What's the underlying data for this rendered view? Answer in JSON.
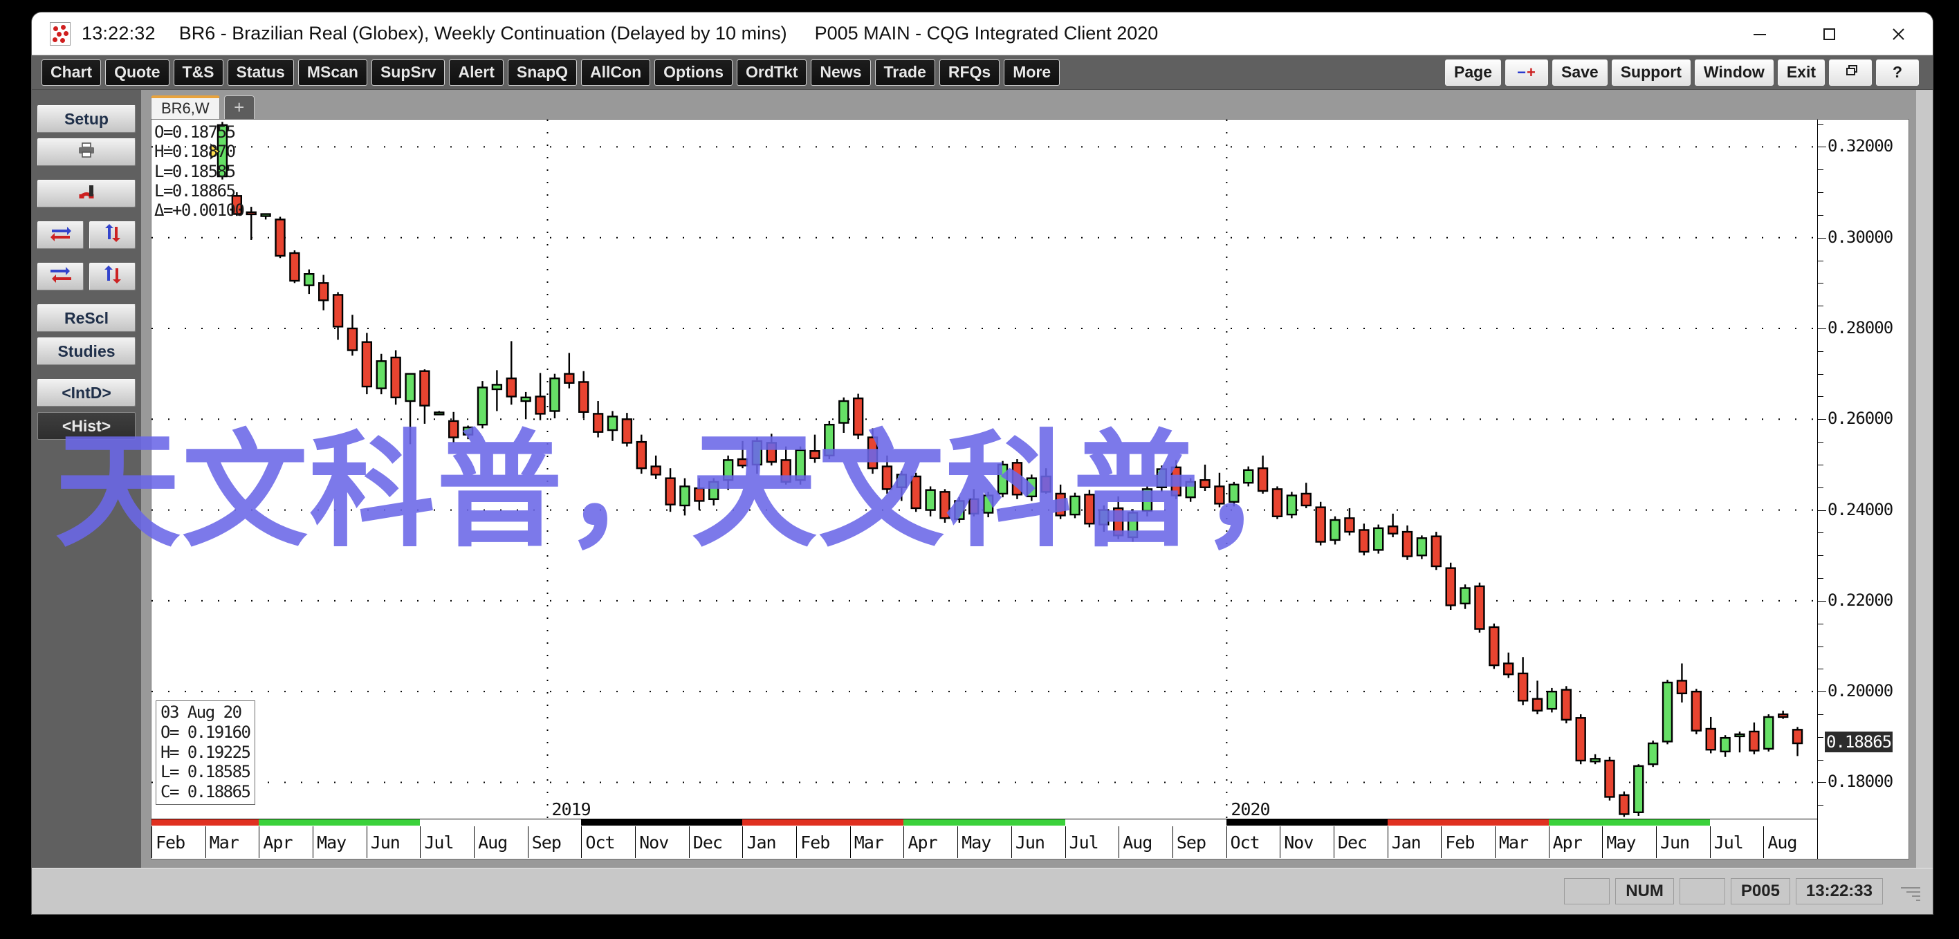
{
  "window": {
    "clock": "13:22:32",
    "title": "BR6 - Brazilian Real (Globex), Weekly Continuation (Delayed by 10 mins)",
    "subtitle": "P005 MAIN - CQG Integrated Client 2020",
    "controls": {
      "minimize": "minimize-icon",
      "maximize": "maximize-icon",
      "close": "close-icon"
    }
  },
  "toolbar": {
    "left_buttons": [
      "Chart",
      "Quote",
      "T&S",
      "Status",
      "MScan",
      "SupSrv",
      "Alert",
      "SnapQ",
      "AllCon",
      "Options",
      "OrdTkt",
      "News",
      "Trade",
      "RFQs",
      "More"
    ],
    "right_buttons": [
      "Page",
      "-+",
      "Save",
      "Support",
      "Window",
      "Exit"
    ],
    "restore_icon": "restore-window-icon",
    "help_icon": "help-question-icon"
  },
  "sidebar": {
    "setup": "Setup",
    "print_icon": "printer-icon",
    "magnet_icon": "magnet-icon",
    "arrow_icons": [
      "swap-horizontal-icon",
      "swap-vertical-icon",
      "collapse-horizontal-icon",
      "expand-vertical-icon"
    ],
    "rescale": "ReScl",
    "studies": "Studies",
    "intraday": "<IntD>",
    "history": "<Hist>"
  },
  "tabs": {
    "active": "BR6,W",
    "add": "+"
  },
  "chart_data": {
    "type": "candlestick",
    "title": "BR6 - Brazilian Real (Globex), Weekly Continuation",
    "xlabel": "",
    "ylabel": "",
    "ylim": [
      0.172,
      0.326
    ],
    "grid": true,
    "price_ticks": [
      "0.32000",
      "0.30000",
      "0.28000",
      "0.26000",
      "0.24000",
      "0.22000",
      "0.20000",
      "0.18000"
    ],
    "price_tick_values": [
      0.32,
      0.3,
      0.28,
      0.26,
      0.24,
      0.22,
      0.2,
      0.18
    ],
    "last_price_label": "0.18865",
    "last_price_value": 0.18865,
    "header": {
      "open": "O=0.18755",
      "high": "H=0.18870",
      "low": "L=0.18585",
      "close": "L=0.18865",
      "delta": "Δ=+0.00100"
    },
    "cursor_box": {
      "date": "03 Aug 20",
      "open": "O= 0.19160",
      "high": "H= 0.19225",
      "low": "L= 0.18585",
      "close": "C= 0.18865"
    },
    "year_labels": [
      "2019",
      "2020"
    ],
    "month_labels": [
      "Feb",
      "Mar",
      "Apr",
      "May",
      "Jun",
      "Jul",
      "Aug",
      "Sep",
      "Oct",
      "Nov",
      "Dec",
      "Jan",
      "Feb",
      "Mar",
      "Apr",
      "May",
      "Jun",
      "Jul",
      "Aug",
      "Sep",
      "Oct",
      "Nov",
      "Dec",
      "Jan",
      "Feb",
      "Mar",
      "Apr",
      "May",
      "Jun",
      "Jul",
      "Aug"
    ],
    "candles": [
      {
        "o": 0.3135,
        "h": 0.3255,
        "l": 0.3128,
        "c": 0.3248,
        "d": "u"
      },
      {
        "o": 0.3092,
        "h": 0.31,
        "l": 0.3048,
        "c": 0.3052,
        "d": "d"
      },
      {
        "o": 0.3056,
        "h": 0.3068,
        "l": 0.2995,
        "c": 0.3056,
        "d": "d"
      },
      {
        "o": 0.305,
        "h": 0.3052,
        "l": 0.304,
        "c": 0.3052,
        "d": "u"
      },
      {
        "o": 0.304,
        "h": 0.3046,
        "l": 0.2955,
        "c": 0.296,
        "d": "d"
      },
      {
        "o": 0.2966,
        "h": 0.2972,
        "l": 0.29,
        "c": 0.2905,
        "d": "d"
      },
      {
        "o": 0.2895,
        "h": 0.293,
        "l": 0.2876,
        "c": 0.292,
        "d": "u"
      },
      {
        "o": 0.29,
        "h": 0.2918,
        "l": 0.284,
        "c": 0.2862,
        "d": "d"
      },
      {
        "o": 0.2874,
        "h": 0.288,
        "l": 0.2775,
        "c": 0.2804,
        "d": "d"
      },
      {
        "o": 0.28,
        "h": 0.283,
        "l": 0.274,
        "c": 0.2752,
        "d": "d"
      },
      {
        "o": 0.277,
        "h": 0.279,
        "l": 0.2655,
        "c": 0.2672,
        "d": "d"
      },
      {
        "o": 0.2668,
        "h": 0.2744,
        "l": 0.2655,
        "c": 0.2728,
        "d": "u"
      },
      {
        "o": 0.2736,
        "h": 0.2752,
        "l": 0.2632,
        "c": 0.2648,
        "d": "d"
      },
      {
        "o": 0.264,
        "h": 0.27,
        "l": 0.2545,
        "c": 0.27,
        "d": "u"
      },
      {
        "o": 0.2706,
        "h": 0.271,
        "l": 0.259,
        "c": 0.263,
        "d": "d"
      },
      {
        "o": 0.2612,
        "h": 0.2618,
        "l": 0.261,
        "c": 0.2615,
        "d": "u"
      },
      {
        "o": 0.2596,
        "h": 0.2616,
        "l": 0.2548,
        "c": 0.256,
        "d": "d"
      },
      {
        "o": 0.2566,
        "h": 0.2586,
        "l": 0.2556,
        "c": 0.2582,
        "d": "u"
      },
      {
        "o": 0.2588,
        "h": 0.2684,
        "l": 0.258,
        "c": 0.267,
        "d": "u"
      },
      {
        "o": 0.2666,
        "h": 0.2708,
        "l": 0.2618,
        "c": 0.2676,
        "d": "u"
      },
      {
        "o": 0.269,
        "h": 0.2772,
        "l": 0.2632,
        "c": 0.265,
        "d": "d"
      },
      {
        "o": 0.264,
        "h": 0.266,
        "l": 0.26,
        "c": 0.2648,
        "d": "u"
      },
      {
        "o": 0.265,
        "h": 0.2702,
        "l": 0.2598,
        "c": 0.2612,
        "d": "d"
      },
      {
        "o": 0.2618,
        "h": 0.27,
        "l": 0.2602,
        "c": 0.269,
        "d": "u"
      },
      {
        "o": 0.27,
        "h": 0.2746,
        "l": 0.2668,
        "c": 0.268,
        "d": "d"
      },
      {
        "o": 0.2682,
        "h": 0.2706,
        "l": 0.2602,
        "c": 0.2616,
        "d": "d"
      },
      {
        "o": 0.2612,
        "h": 0.264,
        "l": 0.256,
        "c": 0.2572,
        "d": "d"
      },
      {
        "o": 0.2576,
        "h": 0.2618,
        "l": 0.2552,
        "c": 0.2606,
        "d": "u"
      },
      {
        "o": 0.26,
        "h": 0.2614,
        "l": 0.254,
        "c": 0.2548,
        "d": "d"
      },
      {
        "o": 0.255,
        "h": 0.2566,
        "l": 0.248,
        "c": 0.2492,
        "d": "d"
      },
      {
        "o": 0.2496,
        "h": 0.252,
        "l": 0.2468,
        "c": 0.2478,
        "d": "d"
      },
      {
        "o": 0.247,
        "h": 0.2492,
        "l": 0.2396,
        "c": 0.2412,
        "d": "d"
      },
      {
        "o": 0.241,
        "h": 0.247,
        "l": 0.2388,
        "c": 0.2452,
        "d": "u"
      },
      {
        "o": 0.2448,
        "h": 0.247,
        "l": 0.24,
        "c": 0.242,
        "d": "d"
      },
      {
        "o": 0.2424,
        "h": 0.247,
        "l": 0.241,
        "c": 0.2462,
        "d": "u"
      },
      {
        "o": 0.2466,
        "h": 0.252,
        "l": 0.2444,
        "c": 0.251,
        "d": "u"
      },
      {
        "o": 0.2512,
        "h": 0.2552,
        "l": 0.2492,
        "c": 0.2498,
        "d": "d"
      },
      {
        "o": 0.25,
        "h": 0.256,
        "l": 0.248,
        "c": 0.2552,
        "d": "u"
      },
      {
        "o": 0.2548,
        "h": 0.2568,
        "l": 0.2498,
        "c": 0.2506,
        "d": "d"
      },
      {
        "o": 0.251,
        "h": 0.254,
        "l": 0.2456,
        "c": 0.2462,
        "d": "d"
      },
      {
        "o": 0.2466,
        "h": 0.254,
        "l": 0.2456,
        "c": 0.2532,
        "d": "u"
      },
      {
        "o": 0.253,
        "h": 0.2566,
        "l": 0.2504,
        "c": 0.2514,
        "d": "d"
      },
      {
        "o": 0.252,
        "h": 0.2596,
        "l": 0.2512,
        "c": 0.2588,
        "d": "u"
      },
      {
        "o": 0.2592,
        "h": 0.2648,
        "l": 0.257,
        "c": 0.264,
        "d": "u"
      },
      {
        "o": 0.2646,
        "h": 0.2656,
        "l": 0.2556,
        "c": 0.2566,
        "d": "d"
      },
      {
        "o": 0.256,
        "h": 0.258,
        "l": 0.248,
        "c": 0.2492,
        "d": "d"
      },
      {
        "o": 0.2496,
        "h": 0.252,
        "l": 0.2436,
        "c": 0.2446,
        "d": "d"
      },
      {
        "o": 0.245,
        "h": 0.2486,
        "l": 0.242,
        "c": 0.2478,
        "d": "u"
      },
      {
        "o": 0.2474,
        "h": 0.2482,
        "l": 0.2396,
        "c": 0.2404,
        "d": "d"
      },
      {
        "o": 0.24,
        "h": 0.2452,
        "l": 0.2386,
        "c": 0.2444,
        "d": "u"
      },
      {
        "o": 0.244,
        "h": 0.2446,
        "l": 0.2372,
        "c": 0.2382,
        "d": "d"
      },
      {
        "o": 0.238,
        "h": 0.2428,
        "l": 0.2372,
        "c": 0.242,
        "d": "u"
      },
      {
        "o": 0.2424,
        "h": 0.2446,
        "l": 0.2386,
        "c": 0.2392,
        "d": "d"
      },
      {
        "o": 0.2394,
        "h": 0.244,
        "l": 0.2384,
        "c": 0.2432,
        "d": "u"
      },
      {
        "o": 0.2436,
        "h": 0.2508,
        "l": 0.2428,
        "c": 0.25,
        "d": "u"
      },
      {
        "o": 0.2504,
        "h": 0.2512,
        "l": 0.2424,
        "c": 0.2434,
        "d": "d"
      },
      {
        "o": 0.243,
        "h": 0.2478,
        "l": 0.242,
        "c": 0.247,
        "d": "u"
      },
      {
        "o": 0.2474,
        "h": 0.2492,
        "l": 0.2436,
        "c": 0.244,
        "d": "d"
      },
      {
        "o": 0.2436,
        "h": 0.2456,
        "l": 0.238,
        "c": 0.2388,
        "d": "d"
      },
      {
        "o": 0.239,
        "h": 0.2438,
        "l": 0.2382,
        "c": 0.243,
        "d": "u"
      },
      {
        "o": 0.2434,
        "h": 0.2444,
        "l": 0.2362,
        "c": 0.237,
        "d": "d"
      },
      {
        "o": 0.2368,
        "h": 0.241,
        "l": 0.2352,
        "c": 0.24,
        "d": "u"
      },
      {
        "o": 0.2404,
        "h": 0.243,
        "l": 0.2336,
        "c": 0.2344,
        "d": "d"
      },
      {
        "o": 0.234,
        "h": 0.2402,
        "l": 0.233,
        "c": 0.2394,
        "d": "u"
      },
      {
        "o": 0.2398,
        "h": 0.2452,
        "l": 0.2386,
        "c": 0.2446,
        "d": "u"
      },
      {
        "o": 0.245,
        "h": 0.2498,
        "l": 0.244,
        "c": 0.249,
        "d": "u"
      },
      {
        "o": 0.2494,
        "h": 0.251,
        "l": 0.2424,
        "c": 0.2432,
        "d": "d"
      },
      {
        "o": 0.2428,
        "h": 0.247,
        "l": 0.2418,
        "c": 0.2462,
        "d": "u"
      },
      {
        "o": 0.2466,
        "h": 0.25,
        "l": 0.2442,
        "c": 0.245,
        "d": "d"
      },
      {
        "o": 0.2452,
        "h": 0.2482,
        "l": 0.2406,
        "c": 0.2414,
        "d": "d"
      },
      {
        "o": 0.2418,
        "h": 0.2462,
        "l": 0.2408,
        "c": 0.2456,
        "d": "u"
      },
      {
        "o": 0.246,
        "h": 0.2496,
        "l": 0.2452,
        "c": 0.2488,
        "d": "u"
      },
      {
        "o": 0.2492,
        "h": 0.252,
        "l": 0.2436,
        "c": 0.2442,
        "d": "d"
      },
      {
        "o": 0.2446,
        "h": 0.2452,
        "l": 0.238,
        "c": 0.2386,
        "d": "d"
      },
      {
        "o": 0.239,
        "h": 0.244,
        "l": 0.2382,
        "c": 0.2432,
        "d": "u"
      },
      {
        "o": 0.2436,
        "h": 0.246,
        "l": 0.2404,
        "c": 0.241,
        "d": "d"
      },
      {
        "o": 0.2406,
        "h": 0.2418,
        "l": 0.2322,
        "c": 0.233,
        "d": "d"
      },
      {
        "o": 0.2334,
        "h": 0.2386,
        "l": 0.2324,
        "c": 0.2378,
        "d": "u"
      },
      {
        "o": 0.2382,
        "h": 0.2404,
        "l": 0.2344,
        "c": 0.2352,
        "d": "d"
      },
      {
        "o": 0.2356,
        "h": 0.237,
        "l": 0.23,
        "c": 0.2308,
        "d": "d"
      },
      {
        "o": 0.2312,
        "h": 0.2368,
        "l": 0.2304,
        "c": 0.236,
        "d": "u"
      },
      {
        "o": 0.2364,
        "h": 0.2392,
        "l": 0.234,
        "c": 0.2348,
        "d": "d"
      },
      {
        "o": 0.2352,
        "h": 0.2366,
        "l": 0.229,
        "c": 0.2298,
        "d": "d"
      },
      {
        "o": 0.23,
        "h": 0.2344,
        "l": 0.2292,
        "c": 0.2338,
        "d": "u"
      },
      {
        "o": 0.2342,
        "h": 0.2352,
        "l": 0.2268,
        "c": 0.2276,
        "d": "d"
      },
      {
        "o": 0.2272,
        "h": 0.2284,
        "l": 0.218,
        "c": 0.219,
        "d": "d"
      },
      {
        "o": 0.2194,
        "h": 0.2236,
        "l": 0.2182,
        "c": 0.2228,
        "d": "u"
      },
      {
        "o": 0.2232,
        "h": 0.224,
        "l": 0.213,
        "c": 0.2138,
        "d": "d"
      },
      {
        "o": 0.2142,
        "h": 0.215,
        "l": 0.205,
        "c": 0.2058,
        "d": "d"
      },
      {
        "o": 0.2062,
        "h": 0.2086,
        "l": 0.203,
        "c": 0.2038,
        "d": "d"
      },
      {
        "o": 0.204,
        "h": 0.2076,
        "l": 0.197,
        "c": 0.198,
        "d": "d"
      },
      {
        "o": 0.1984,
        "h": 0.2024,
        "l": 0.195,
        "c": 0.1958,
        "d": "d"
      },
      {
        "o": 0.1962,
        "h": 0.2008,
        "l": 0.1954,
        "c": 0.2,
        "d": "u"
      },
      {
        "o": 0.2004,
        "h": 0.2012,
        "l": 0.193,
        "c": 0.1938,
        "d": "d"
      },
      {
        "o": 0.1942,
        "h": 0.195,
        "l": 0.184,
        "c": 0.1848,
        "d": "d"
      },
      {
        "o": 0.1852,
        "h": 0.1862,
        "l": 0.184,
        "c": 0.1846,
        "d": "u"
      },
      {
        "o": 0.1848,
        "h": 0.1856,
        "l": 0.176,
        "c": 0.1768,
        "d": "d"
      },
      {
        "o": 0.1772,
        "h": 0.178,
        "l": 0.1724,
        "c": 0.173,
        "d": "d"
      },
      {
        "o": 0.1734,
        "h": 0.184,
        "l": 0.1726,
        "c": 0.1836,
        "d": "u"
      },
      {
        "o": 0.184,
        "h": 0.1892,
        "l": 0.1834,
        "c": 0.1886,
        "d": "u"
      },
      {
        "o": 0.189,
        "h": 0.2026,
        "l": 0.1884,
        "c": 0.202,
        "d": "u"
      },
      {
        "o": 0.2024,
        "h": 0.2062,
        "l": 0.1976,
        "c": 0.1996,
        "d": "d"
      },
      {
        "o": 0.2,
        "h": 0.2006,
        "l": 0.1906,
        "c": 0.1914,
        "d": "d"
      },
      {
        "o": 0.1918,
        "h": 0.1944,
        "l": 0.1864,
        "c": 0.1872,
        "d": "d"
      },
      {
        "o": 0.1868,
        "h": 0.1904,
        "l": 0.1856,
        "c": 0.1898,
        "d": "u"
      },
      {
        "o": 0.1902,
        "h": 0.1912,
        "l": 0.1866,
        "c": 0.1906,
        "d": "u"
      },
      {
        "o": 0.1912,
        "h": 0.1932,
        "l": 0.1862,
        "c": 0.187,
        "d": "d"
      },
      {
        "o": 0.1874,
        "h": 0.195,
        "l": 0.1868,
        "c": 0.1944,
        "d": "u"
      },
      {
        "o": 0.195,
        "h": 0.1958,
        "l": 0.194,
        "c": 0.1944,
        "d": "d"
      },
      {
        "o": 0.1916,
        "h": 0.1922,
        "l": 0.1858,
        "c": 0.1886,
        "d": "d"
      }
    ]
  },
  "watermark": {
    "text": "天文科普，天文科普，",
    "color": "#6b67e8"
  },
  "statusbar": {
    "num": "NUM",
    "page": "P005",
    "clock": "13:22:33"
  }
}
